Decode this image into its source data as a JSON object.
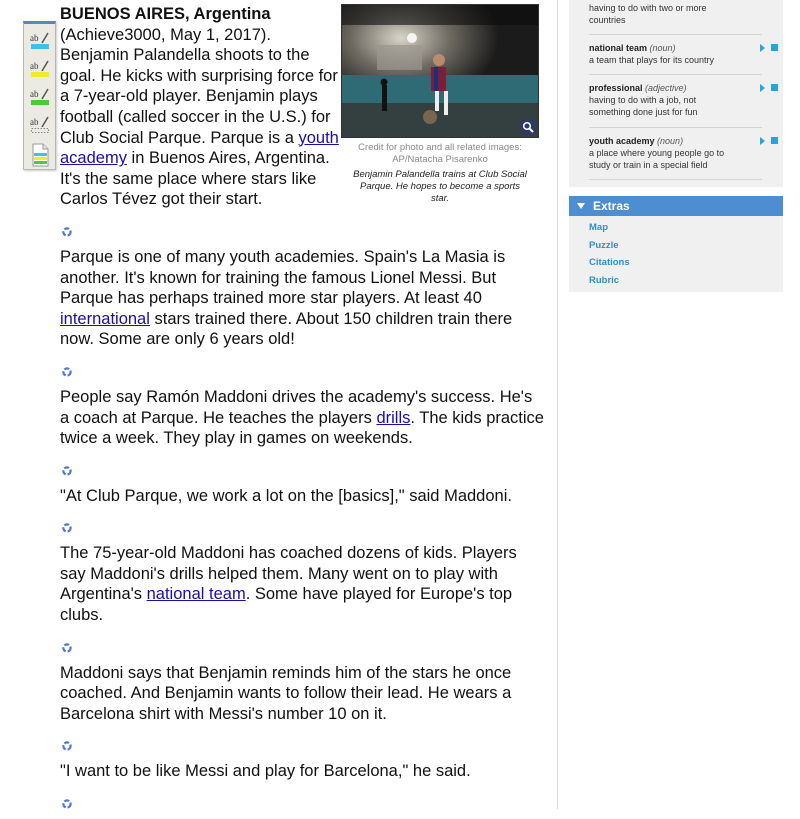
{
  "article": {
    "dateline": "BUENOS AIRES, Argentina",
    "lead_lines_pre": " (Achieve3000, May 1, 2017). Benjamin Palandella shoots to the goal. He kicks with surprising force for a 7-year-old player. Benjamin plays football (called soccer in the U.S.) for Club Social Parque. Parque is a ",
    "lead_link": "youth academy",
    "lead_post": " in Buenos Aires, Argentina. It's the same place where stars like Carlos Tévez got their start.",
    "paragraphs": [
      {
        "pre": "Parque is one of many youth academies. Spain's La Masia is another. It's known for training the famous Lionel Messi. But Parque has perhaps trained more star players. At least 40 ",
        "link": "international",
        "post": " stars trained there. About 150 children train there now. Some are only 6 years old!"
      },
      {
        "pre": "People say Ramón Maddoni drives the academy's success. He's a coach at Parque. He teaches the players ",
        "link": "drills",
        "post": ". The kids practice twice a week. They play in games on weekends."
      },
      {
        "pre": "\"At Club Parque, we work a lot on the [basics],\" said Maddoni.",
        "link": "",
        "post": ""
      },
      {
        "pre": "The 75-year-old Maddoni has coached dozens of kids. Players say Maddoni's drills helped them. Many went on to play with Argentina's ",
        "link": "national team",
        "post": ". Some have played for Europe's top clubs."
      },
      {
        "pre": "Maddoni says that Benjamin reminds him of the stars he once coached. And Benjamin wants to follow their lead. He wears a Barcelona shirt with Messi's number 10 on it.",
        "link": "",
        "post": ""
      },
      {
        "pre": "\"I want to be like Messi and play for Barcelona,\" he said.",
        "link": "",
        "post": ""
      }
    ]
  },
  "figure": {
    "credit": "Credit for photo and all related images: AP/Natacha Pisarenko",
    "caption": "Benjamin Palandella trains at Club Social Parque. He hopes to become a sports star.",
    "zoom_icon": "magnifier-icon"
  },
  "toolbar": {
    "tools": [
      {
        "name": "highlight-blue",
        "color": "#3cc3e6"
      },
      {
        "name": "highlight-yellow",
        "color": "#f2ea2e"
      },
      {
        "name": "highlight-green",
        "color": "#4ccb3a"
      },
      {
        "name": "highlight-erase",
        "color": "none"
      },
      {
        "name": "notes",
        "color": "notes"
      }
    ]
  },
  "vocabulary": {
    "partial_definition": "having to do with two or more countries",
    "entries": [
      {
        "term": "national team",
        "pos": "(noun)",
        "definition": "a team that plays for its country"
      },
      {
        "term": "professional",
        "pos": "(adjective)",
        "definition": "having to do with a job, not something done just for fun"
      },
      {
        "term": "youth academy",
        "pos": "(noun)",
        "definition": "a place where young people go to study or train in a special field"
      }
    ]
  },
  "extras": {
    "title": "Extras",
    "links": [
      "Map",
      "Puzzle",
      "Citations",
      "Rubric"
    ]
  },
  "colors": {
    "link": "#1a0dab",
    "accent_blue": "#4c8ecf",
    "extras_link": "#2a8fd0",
    "audio_control": "#2aa3d6"
  }
}
